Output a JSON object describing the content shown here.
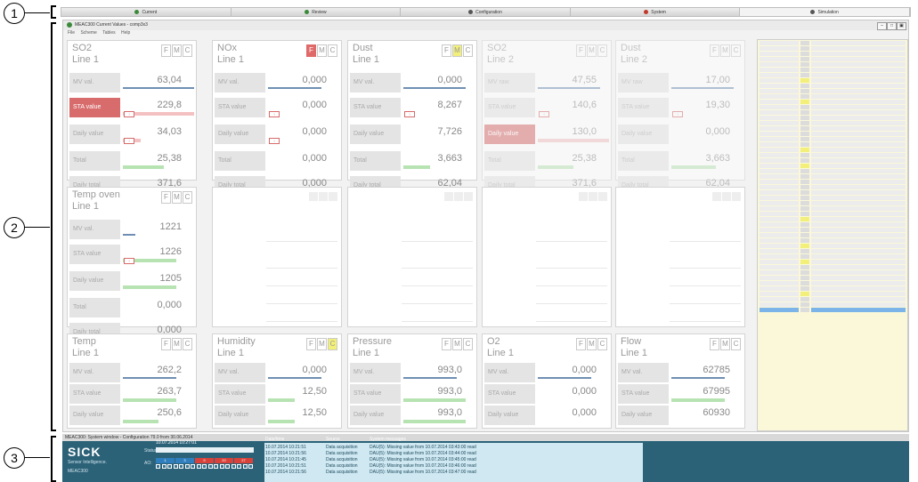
{
  "callouts": [
    "1",
    "2",
    "3"
  ],
  "tabs": [
    {
      "label": "Current",
      "color": "#3b8a3b"
    },
    {
      "label": "Review",
      "color": "#3b8a3b"
    },
    {
      "label": "Configuration",
      "color": "#555555"
    },
    {
      "label": "System",
      "color": "#c0392b"
    },
    {
      "label": "Simulation",
      "color": "#555555"
    }
  ],
  "window": {
    "title": "MEAC300 Current Values - comp3x3",
    "menu": [
      "File",
      "Scheme",
      "Tables",
      "Help"
    ]
  },
  "panels_row1": [
    {
      "title1": "SO2",
      "title2": "Line 1",
      "fmc": [
        "F",
        "M",
        "C"
      ],
      "mv": "63,04",
      "sta": "229,8",
      "daily": "34,03",
      "total": "25,38",
      "dtotal": "371,6"
    },
    {
      "title1": "NOx",
      "title2": "Line 1",
      "fmc": [
        "F",
        "M",
        "C"
      ],
      "mv": "0,000",
      "sta": "0,000",
      "daily": "0,000",
      "total": "0,000",
      "dtotal": "0,000"
    },
    {
      "title1": "Dust",
      "title2": "Line 1",
      "fmc": [
        "F",
        "M",
        "C"
      ],
      "mv": "0,000",
      "sta": "8,267",
      "daily": "7,726",
      "total": "3,663",
      "dtotal": "62,04"
    },
    {
      "title1": "SO2",
      "title2": "Line 2",
      "fmc": [
        "F",
        "M",
        "C"
      ],
      "mv": "47,55",
      "sta": "140,6",
      "daily": "130,0",
      "total": "25,38",
      "dtotal": "371,6"
    },
    {
      "title1": "Dust",
      "title2": "Line 2",
      "fmc": [
        "F",
        "M",
        "C"
      ],
      "mv": "17,00",
      "sta": "19,30",
      "daily": "0,000",
      "total": "3,663",
      "dtotal": "62,04"
    }
  ],
  "temp_oven": {
    "title1": "Temp oven",
    "title2": "Line 1",
    "fmc": [
      "F",
      "M",
      "C"
    ],
    "mv": "1221",
    "sta": "1226",
    "daily": "1205",
    "total": "0,000",
    "dtotal": "0,000"
  },
  "panels_row3": [
    {
      "title1": "Temp",
      "title2": "Line 1",
      "fmc": [
        "F",
        "M",
        "C"
      ],
      "mv": "262,2",
      "sta": "263,7",
      "daily": "250,6"
    },
    {
      "title1": "Humidity",
      "title2": "Line 1",
      "fmc": [
        "F",
        "M",
        "C"
      ],
      "mv": "0,000",
      "sta": "12,50",
      "daily": "12,50"
    },
    {
      "title1": "Pressure",
      "title2": "Line 1",
      "fmc": [
        "F",
        "M",
        "C"
      ],
      "mv": "993,0",
      "sta": "993,0",
      "daily": "993,0"
    },
    {
      "title1": "O2",
      "title2": "Line 1",
      "fmc": [
        "F",
        "M",
        "C"
      ],
      "mv": "0,000",
      "sta": "0,000",
      "daily": "0,000"
    },
    {
      "title1": "Flow",
      "title2": "Line 1",
      "fmc": [
        "F",
        "M",
        "C"
      ],
      "mv": "62785",
      "sta": "67995",
      "daily": "60930"
    }
  ],
  "labels": {
    "mv": "MV val.",
    "mv_raw": "MV raw",
    "sta": "STA value",
    "daily": "Daily value",
    "total": "Total",
    "dtotal": "Daily total"
  },
  "system": {
    "title": "MEAC300: System window - Configuration 79.0 from 30.06.2014",
    "brand": "SICK",
    "tagline": "Sensor Intelligence.",
    "product": "MEAC300",
    "status_label": "Status:",
    "status_date": "10.07.2014 10:27:01",
    "ao_label": "AO:",
    "lanes": [
      "1",
      "3",
      "9",
      "20",
      "27"
    ],
    "headers": [
      "Date/time",
      "Source",
      "System messages"
    ],
    "messages": [
      {
        "time": "10.07.2014 10:21:51",
        "source": "Data acquisition",
        "msg": "DAU(5): Missing value from 10.07.2014 03:43:00 read"
      },
      {
        "time": "10.07.2014 10:21:56",
        "source": "Data acquisition",
        "msg": "DAU(5): Missing value from 10.07.2014 03:44:00 read"
      },
      {
        "time": "10.07.2014 10:21:45",
        "source": "Data acquisition",
        "msg": "DAU(5): Missing value from 10.07.2014 03:45:00 read"
      },
      {
        "time": "10.07.2014 10:21:51",
        "source": "Data acquisition",
        "msg": "DAU(5): Missing value from 10.07.2014 03:46:00 read"
      },
      {
        "time": "10.07.2014 10:21:56",
        "source": "Data acquisition",
        "msg": "DAU(5): Missing value from 10.07.2014 03:47:00 read"
      }
    ]
  }
}
